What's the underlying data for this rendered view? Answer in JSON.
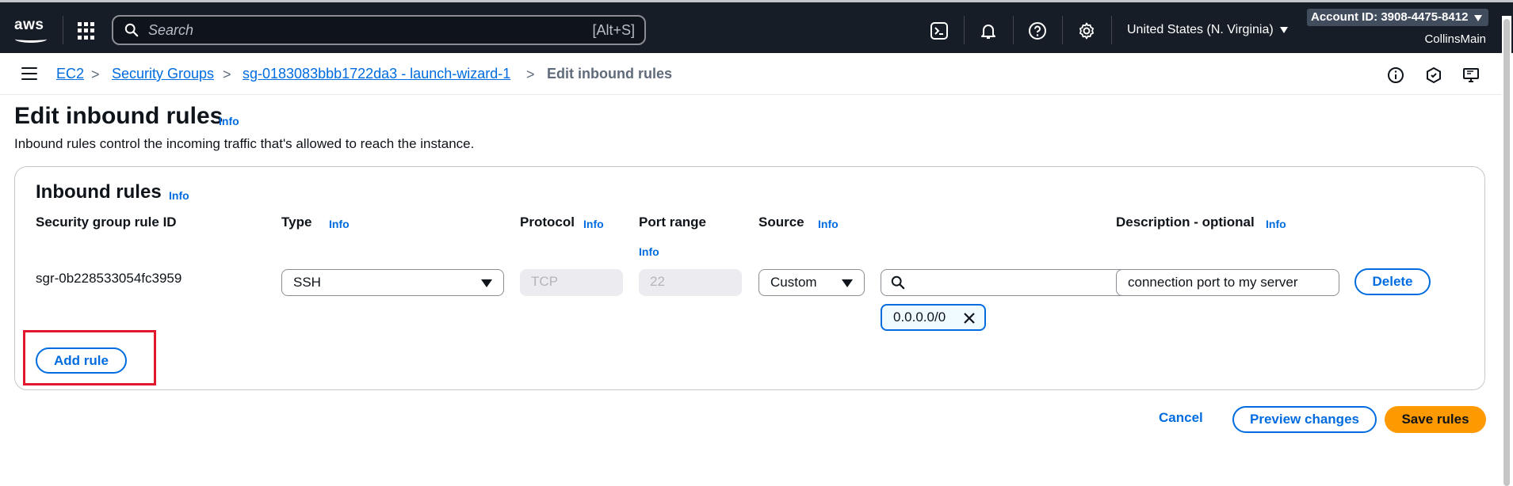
{
  "topnav": {
    "logo_text": "aws",
    "search_placeholder": "Search",
    "search_shortcut": "[Alt+S]",
    "region": "United States (N. Virginia)",
    "account": "Account ID: 3908-4475-8412",
    "username": "CollinsMain",
    "icons": [
      "cloudshell-icon",
      "bell-icon",
      "help-icon",
      "gear-icon"
    ]
  },
  "breadcrumb": {
    "items": [
      "EC2",
      "Security Groups",
      "sg-0183083bbb1722da3 - launch-wizard-1"
    ],
    "current": "Edit inbound rules",
    "separator": ">"
  },
  "page": {
    "title": "Edit inbound rules",
    "info": "Info",
    "description": "Inbound rules control the incoming traffic that's allowed to reach the instance."
  },
  "inbound": {
    "title": "Inbound rules",
    "info": "Info",
    "columns": {
      "rule_id": "Security group rule ID",
      "type": "Type",
      "protocol": "Protocol",
      "port_range": "Port range",
      "source": "Source",
      "description": "Description - optional"
    },
    "rule": {
      "id": "sgr-0b228533054fc3959",
      "type": "SSH",
      "protocol": "TCP",
      "port": "22",
      "source_type": "Custom",
      "source_token": "0.0.0.0/0",
      "description": "connection port to my server"
    },
    "delete_label": "Delete",
    "add_rule_label": "Add rule"
  },
  "footer": {
    "cancel": "Cancel",
    "preview": "Preview changes",
    "save": "Save rules"
  },
  "colors": {
    "nav_bg": "#161d26",
    "link": "#006ce0",
    "primary": "#ff9900",
    "highlight": "#e0182d"
  }
}
